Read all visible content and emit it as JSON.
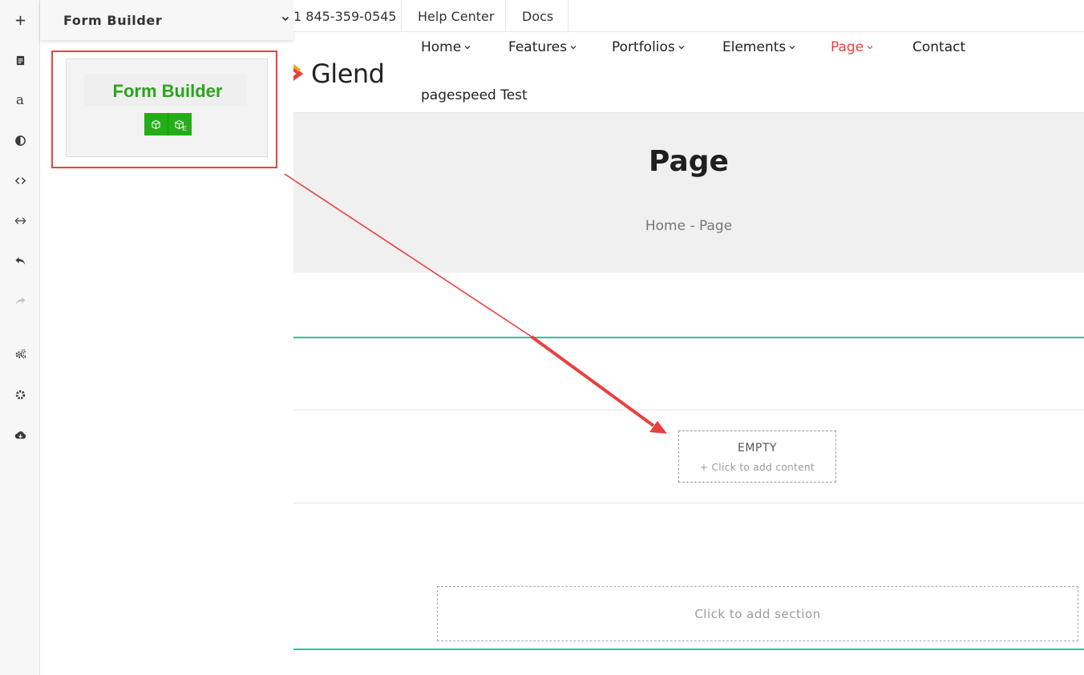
{
  "toolbar": {
    "tools": [
      {
        "name": "add-icon"
      },
      {
        "name": "page-icon"
      },
      {
        "name": "font-icon",
        "glyph": "a"
      },
      {
        "name": "contrast-icon"
      },
      {
        "name": "code-icon"
      },
      {
        "name": "resize-horizontal-icon"
      },
      {
        "name": "undo-icon"
      },
      {
        "name": "redo-icon"
      },
      {
        "name": "settings-group-icon"
      },
      {
        "name": "gear-icon"
      },
      {
        "name": "cloud-download-icon"
      }
    ]
  },
  "panel": {
    "title": "Form Builder",
    "widget": {
      "name": "Form Builder",
      "action_sub": "E"
    }
  },
  "topbar": {
    "phone": "1 845-359-0545",
    "help": "Help Center",
    "docs": "Docs"
  },
  "header": {
    "logo_text": "Glend",
    "nav": [
      {
        "label": "Home"
      },
      {
        "label": "Features"
      },
      {
        "label": "Portfolios"
      },
      {
        "label": "Elements"
      },
      {
        "label": "Page"
      },
      {
        "label": "Contact"
      },
      {
        "label": "pagespeed Test"
      }
    ]
  },
  "banner": {
    "title": "Page",
    "breadcrumb_home": "Home",
    "breadcrumb_sep": "-",
    "breadcrumb_current": "Page"
  },
  "builder": {
    "empty_title": "EMPTY",
    "empty_sub": "+ Click to add content",
    "add_section": "Click to add section"
  },
  "colors": {
    "accent_red": "#e8413f",
    "builder_green": "#23ad17",
    "section_line": "#1ccb98"
  }
}
